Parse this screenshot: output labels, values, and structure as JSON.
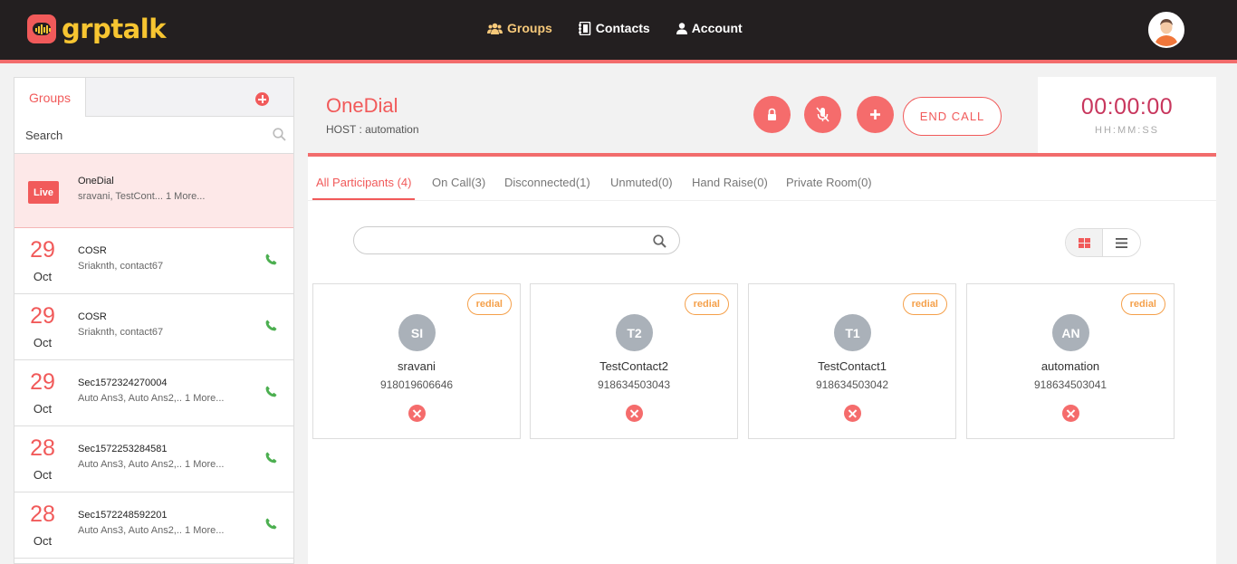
{
  "app": {
    "logo_text": "grptalk"
  },
  "nav": [
    {
      "label": "Groups",
      "icon": "users-icon",
      "active": true
    },
    {
      "label": "Contacts",
      "icon": "address-book-icon",
      "active": false
    },
    {
      "label": "Account",
      "icon": "user-icon",
      "active": false
    }
  ],
  "sidebar": {
    "tab_label": "Groups",
    "search_placeholder": "Search",
    "groups": [
      {
        "live_label": "Live",
        "name": "OneDial",
        "members": "sravani,  TestCont...  1 More..."
      },
      {
        "day": "29",
        "month": "Oct",
        "name": "COSR",
        "members": "Sriaknth,  contact67"
      },
      {
        "day": "29",
        "month": "Oct",
        "name": "COSR",
        "members": "Sriaknth,  contact67"
      },
      {
        "day": "29",
        "month": "Oct",
        "name": "Sec1572324270004",
        "members": "Auto Ans3,  Auto Ans2,..  1 More..."
      },
      {
        "day": "28",
        "month": "Oct",
        "name": "Sec1572253284581",
        "members": "Auto Ans3,  Auto Ans2,..  1 More..."
      },
      {
        "day": "28",
        "month": "Oct",
        "name": "Sec1572248592201",
        "members": "Auto Ans3,  Auto Ans2,..  1 More..."
      }
    ]
  },
  "call": {
    "title": "OneDial",
    "host": "HOST : automation",
    "end_call_label": "END CALL",
    "timer": "00:00:00",
    "timer_format": "HH:MM:SS"
  },
  "participant_tabs": [
    "All Participants (4)",
    "On Call(3)",
    "Disconnected(1)",
    "Unmuted(0)",
    "Hand Raise(0)",
    "Private Room(0)"
  ],
  "participants": [
    {
      "initials": "SI",
      "name": "sravani",
      "number": "918019606646",
      "badge": "redial"
    },
    {
      "initials": "T2",
      "name": "TestContact2",
      "number": "918634503043",
      "badge": "redial"
    },
    {
      "initials": "T1",
      "name": "TestContact1",
      "number": "918634503042",
      "badge": "redial"
    },
    {
      "initials": "AN",
      "name": "automation",
      "number": "918634503041",
      "badge": "redial"
    }
  ],
  "colors": {
    "accent": "#f15a5a",
    "brand_yellow": "#f7c531",
    "timer": "#c8365d",
    "redial": "#f5a04a"
  }
}
